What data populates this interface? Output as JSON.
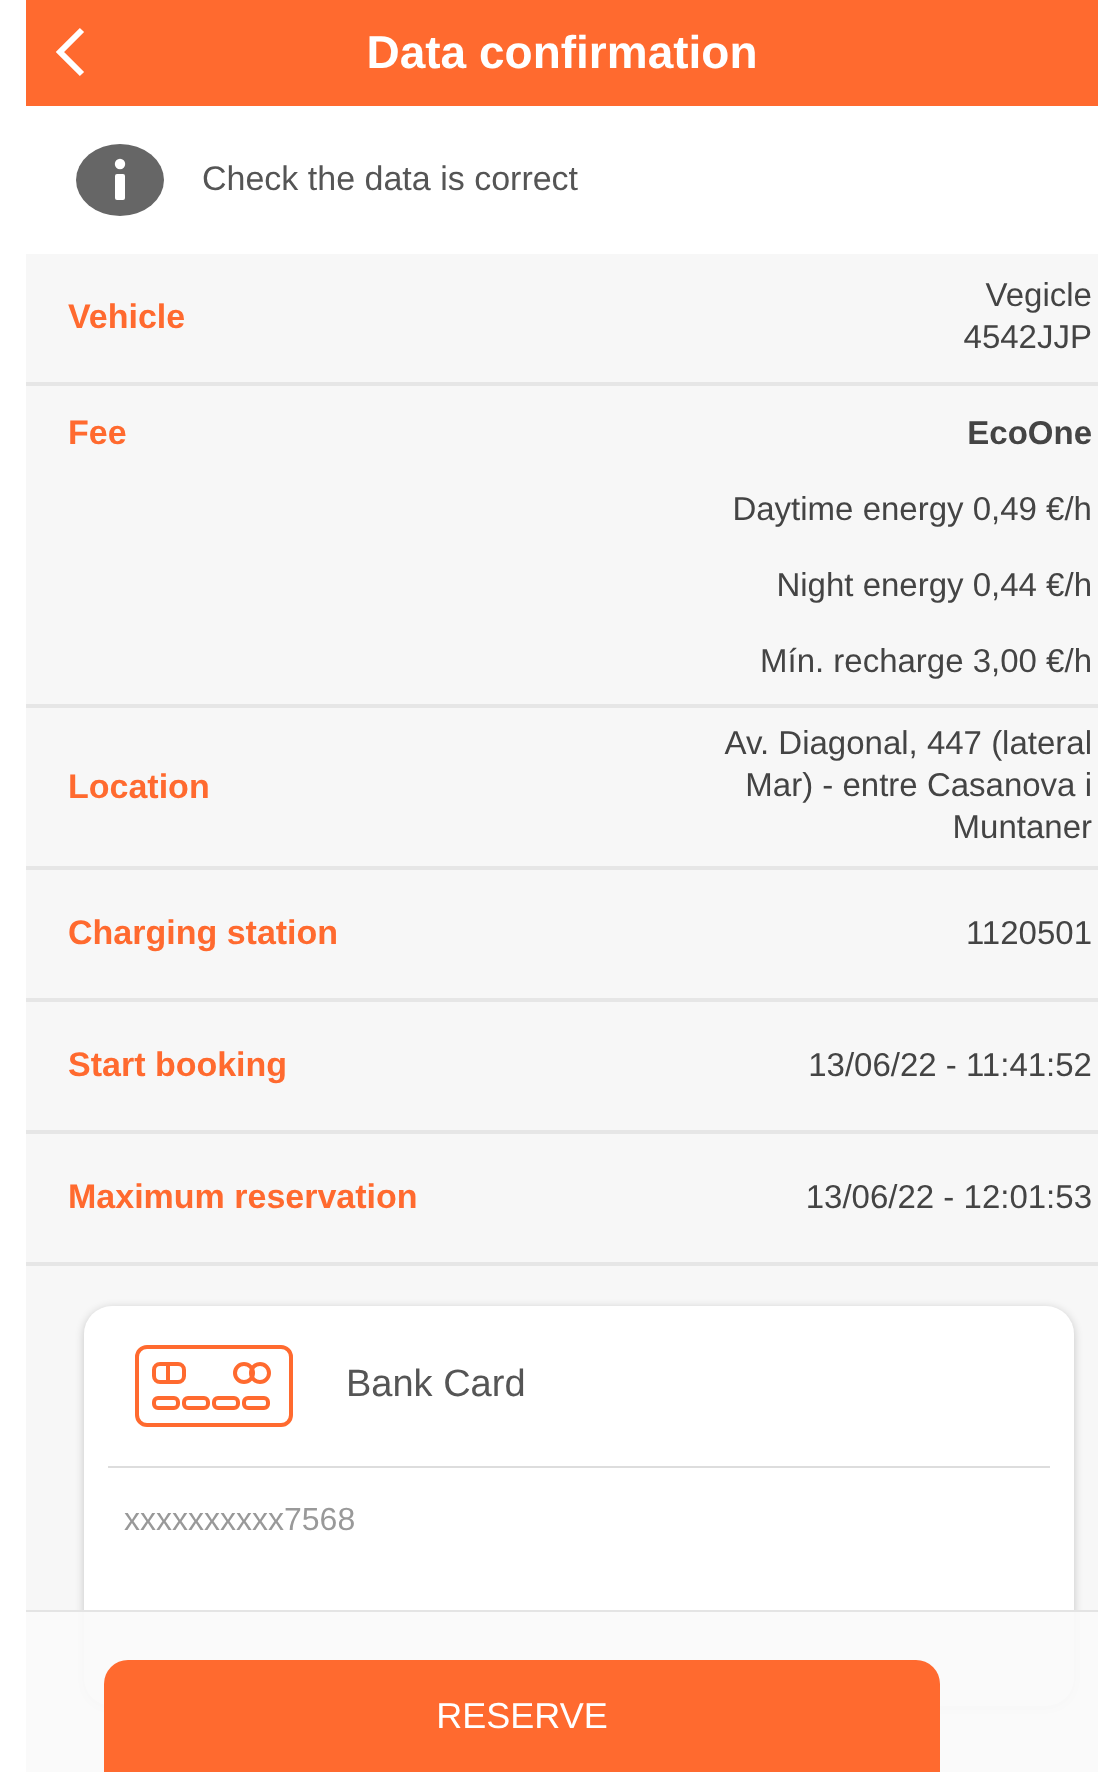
{
  "header": {
    "title": "Data confirmation"
  },
  "notice": "Check the data is correct",
  "rows": [
    {
      "kind": "lines",
      "label": "Vehicle",
      "lines": [
        "Vegicle",
        "4542JJP"
      ]
    },
    {
      "kind": "fee",
      "label": "Fee",
      "name": "EcoOne",
      "prices": [
        "Daytime energy 0,49 €/h",
        "Night energy 0,44 €/h",
        "Mín. recharge 3,00 €/h"
      ]
    },
    {
      "kind": "lines",
      "label": "Location",
      "lines": [
        "Av. Diagonal, 447 (lateral",
        "Mar) - entre Casanova i",
        "Muntaner"
      ]
    },
    {
      "kind": "lines",
      "label": "Charging station",
      "lines": [
        "1120501"
      ]
    },
    {
      "kind": "lines",
      "label": "Start booking",
      "lines": [
        "13/06/22 - 11:41:52"
      ]
    },
    {
      "kind": "lines",
      "label": "Maximum reservation",
      "lines": [
        "13/06/22 - 12:01:53"
      ]
    }
  ],
  "payment": {
    "title": "Bank Card",
    "number": "xxxxxxxxxx7568"
  },
  "reserve_button": "RESERVE"
}
